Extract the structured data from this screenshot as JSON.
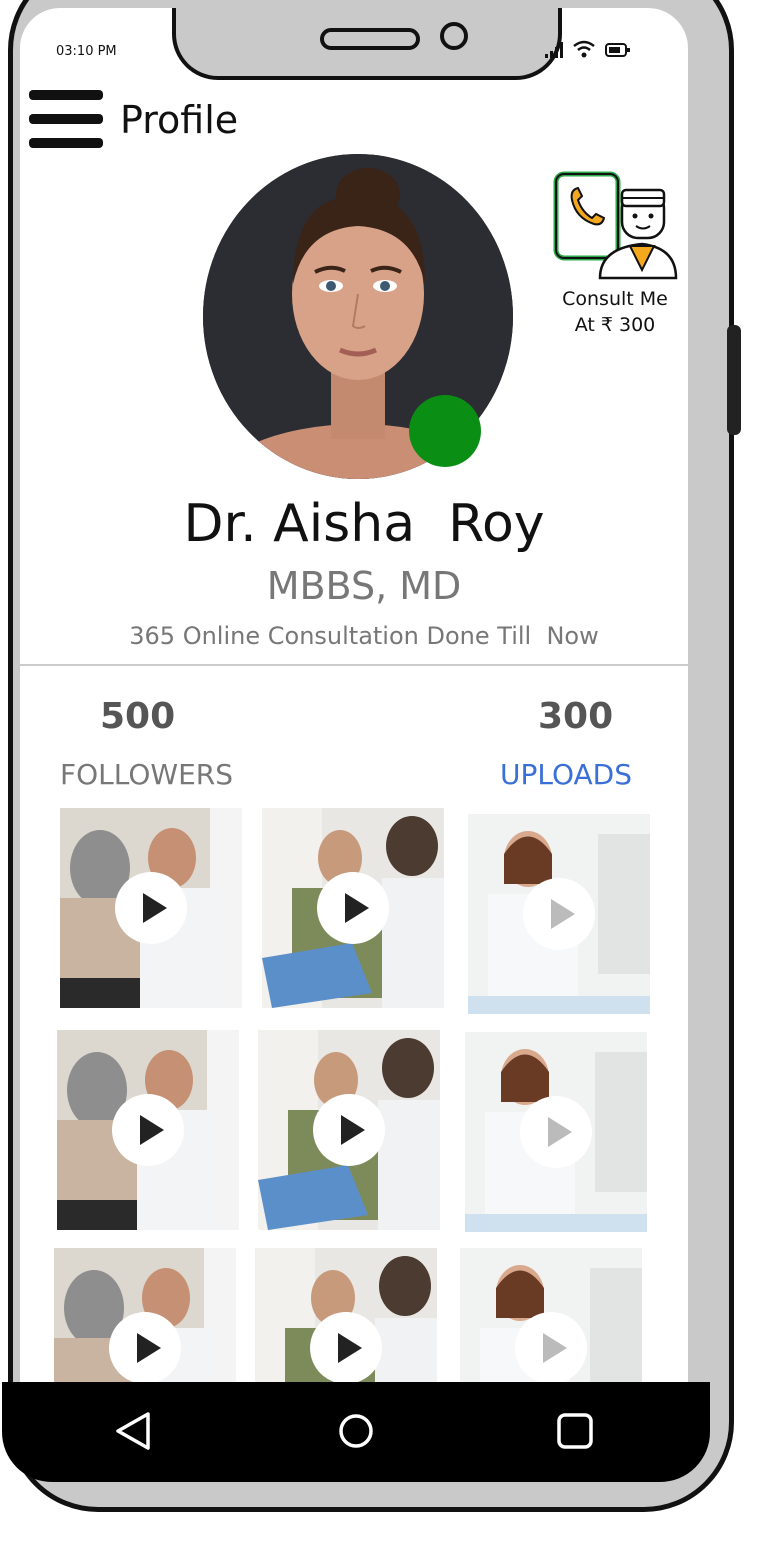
{
  "status_bar": {
    "time": "03:10 PM"
  },
  "header": {
    "title": "Profile",
    "menu_icon": "hamburger-menu-icon"
  },
  "consult": {
    "line1": "Consult Me",
    "line2": "At ₹ 300",
    "icon": "doctor-phone-call-icon"
  },
  "profile": {
    "name": "Dr. Aisha  Roy",
    "degree": "MBBS, MD",
    "consultations": "365 Online Consultation Done Till  Now",
    "online": true
  },
  "stats": {
    "followers_value": "500",
    "followers_label": "FOLLOWERS",
    "uploads_value": "300",
    "uploads_label": "UPLOADS"
  },
  "videos": [
    {
      "scene": "doctor-with-elderly-patient"
    },
    {
      "scene": "doctor-with-patient-documents"
    },
    {
      "scene": "female-doctor-at-desk"
    },
    {
      "scene": "doctor-with-elderly-patient"
    },
    {
      "scene": "doctor-with-patient-documents"
    },
    {
      "scene": "female-doctor-at-desk"
    },
    {
      "scene": "doctor-with-elderly-patient"
    },
    {
      "scene": "doctor-with-patient-documents"
    },
    {
      "scene": "female-doctor-at-desk"
    }
  ],
  "nav": {
    "back_icon": "back-triangle-icon",
    "home_icon": "home-circle-icon",
    "recents_icon": "recents-square-icon"
  },
  "colors": {
    "online": "#0a8f14",
    "uploads_link": "#3a6fd8",
    "muted_text": "#777777",
    "shell": "#c9c9c9"
  }
}
